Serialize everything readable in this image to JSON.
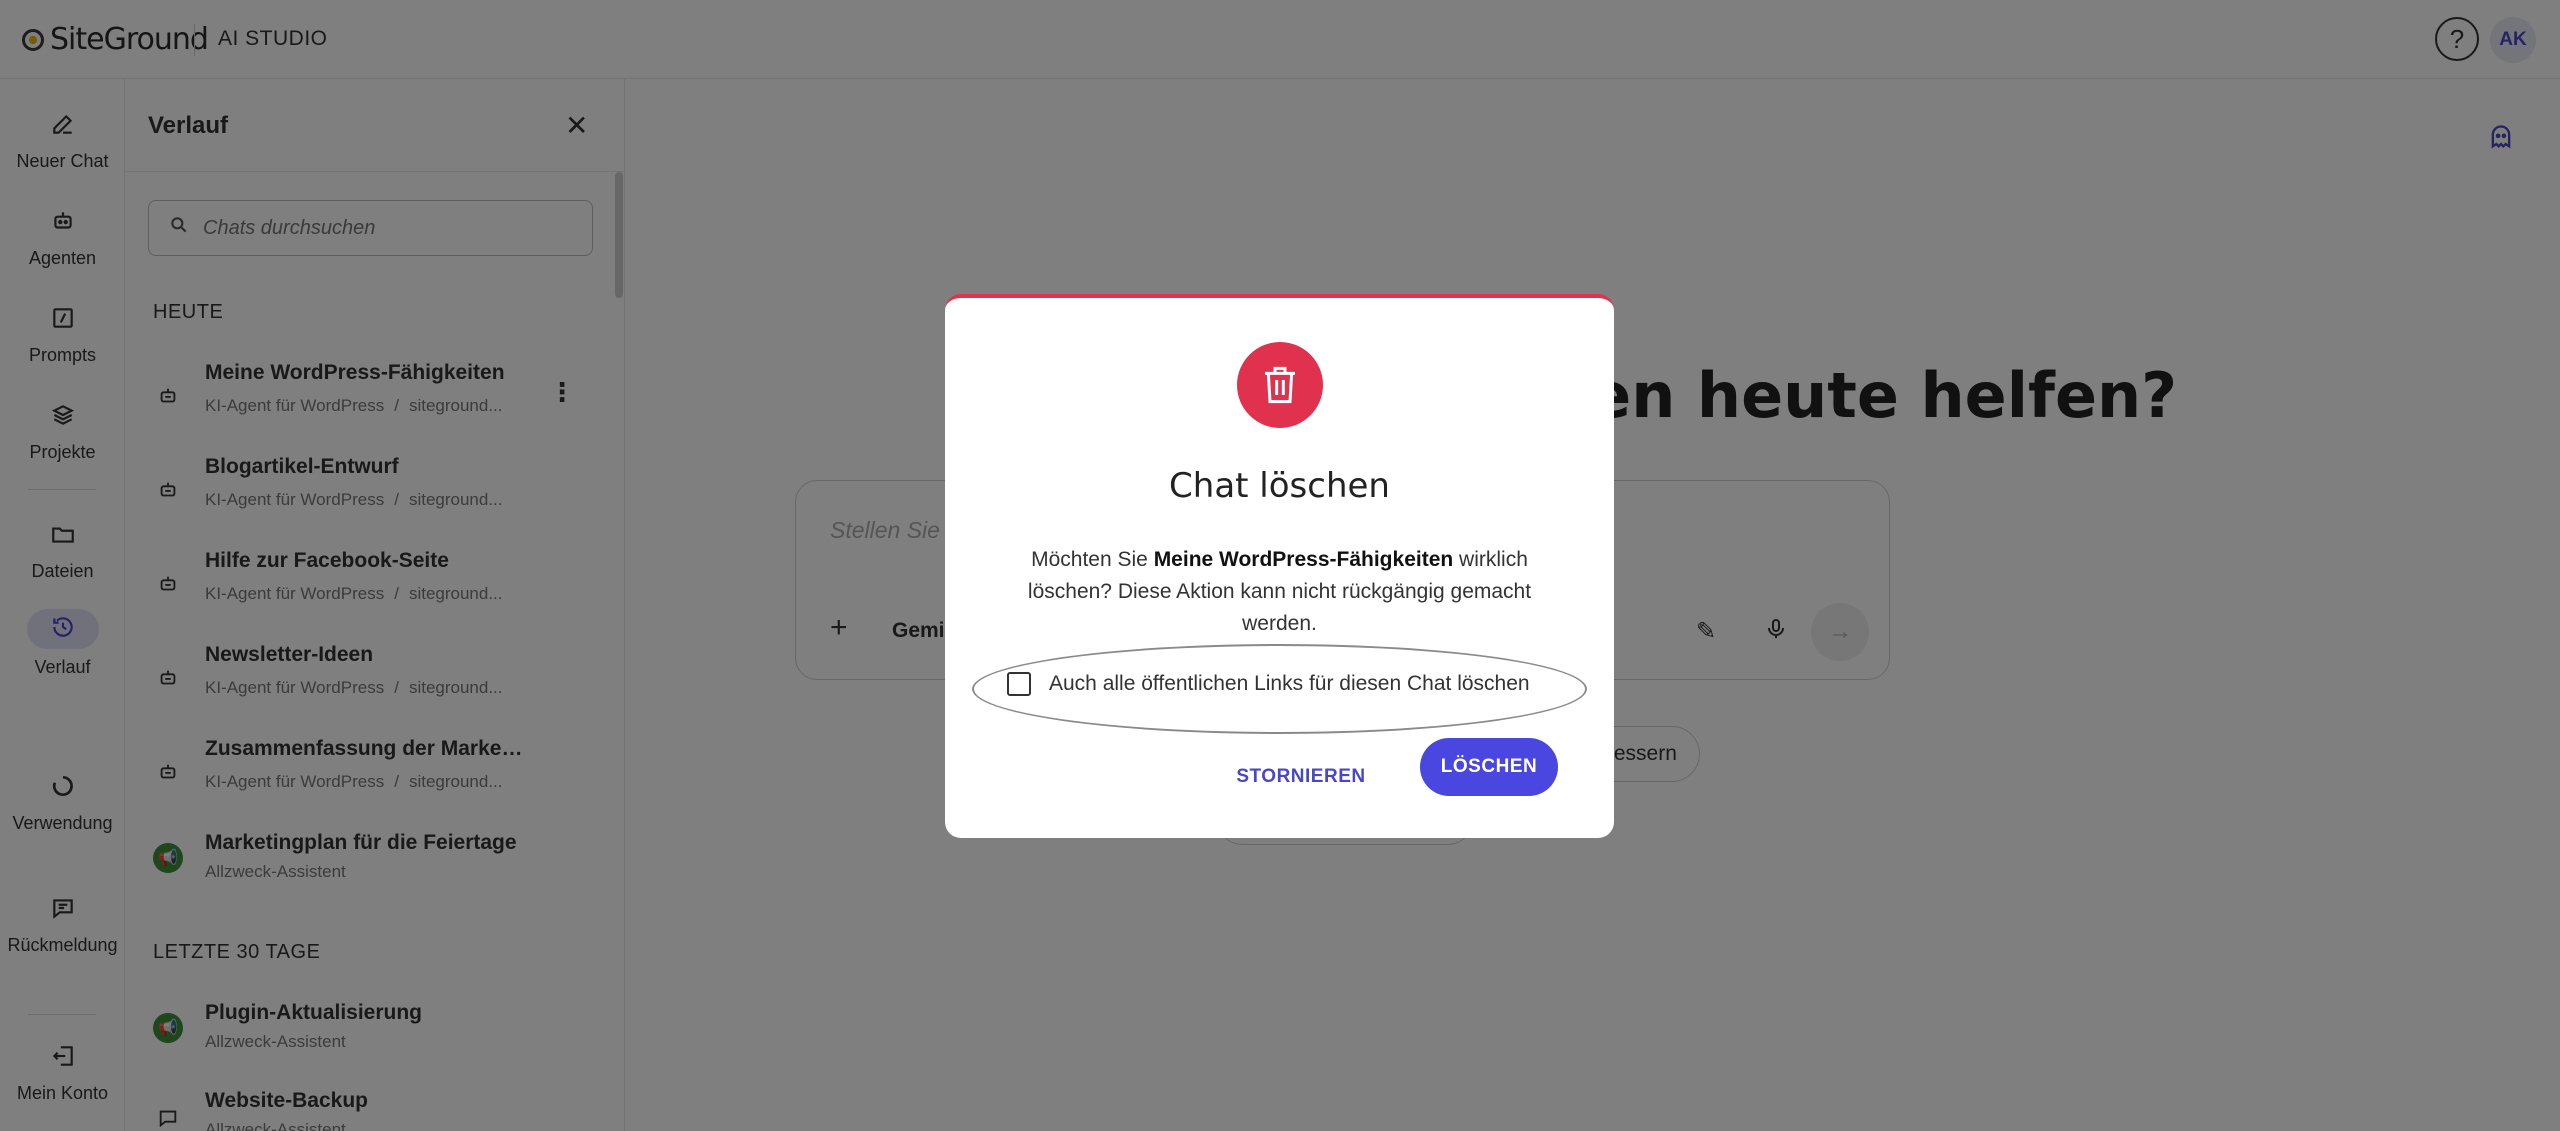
{
  "header": {
    "brand": "SiteGround",
    "app_title": "AI STUDIO",
    "help_icon": "question-icon",
    "avatar_initials": "AK"
  },
  "rail": {
    "items": [
      {
        "label": "Neuer Chat",
        "icon": "edit-icon"
      },
      {
        "label": "Agenten",
        "icon": "robot-icon"
      },
      {
        "label": "Prompts",
        "icon": "prompt-icon"
      },
      {
        "label": "Projekte",
        "icon": "layers-icon"
      },
      {
        "label": "Dateien",
        "icon": "folder-icon"
      },
      {
        "label": "Verlauf",
        "icon": "history-icon",
        "active": true
      },
      {
        "label": "Verwendung",
        "icon": "usage-icon"
      },
      {
        "label": "Rückmeldung",
        "icon": "feedback-icon"
      },
      {
        "label": "Mein Konto",
        "icon": "logout-icon"
      }
    ]
  },
  "history": {
    "title": "Verlauf",
    "search_placeholder": "Chats durchsuchen",
    "section_today": "HEUTE",
    "section_last30": "LETZTE 30 TAGE",
    "today": [
      {
        "title": "Meine WordPress-Fähigkeiten",
        "agent": "KI-Agent für WordPress",
        "site": "siteground..."
      },
      {
        "title": "Blogartikel-Entwurf",
        "agent": "KI-Agent für WordPress",
        "site": "siteground..."
      },
      {
        "title": "Hilfe zur Facebook-Seite",
        "agent": "KI-Agent für WordPress",
        "site": "siteground..."
      },
      {
        "title": "Newsletter-Ideen",
        "agent": "KI-Agent für WordPress",
        "site": "siteground..."
      },
      {
        "title": "Zusammenfassung der Markenr...",
        "agent": "KI-Agent für WordPress",
        "site": "siteground..."
      },
      {
        "title": "Marketingplan für die Feiertage",
        "agent": "Allzweck-Assistent"
      }
    ],
    "last30": [
      {
        "title": "Plugin-Aktualisierung",
        "agent": "Allzweck-Assistent"
      },
      {
        "title": "Website-Backup",
        "agent": "Allzweck-Assistent"
      }
    ],
    "separator": "/"
  },
  "main": {
    "greeting": "Wie kann ich Ihnen heute helfen?",
    "composer_placeholder": "Stellen Sie eine Frage oder nutzen Sie / für Prompts.",
    "model_label": "Gemini",
    "suggestion": "verbessern"
  },
  "modal": {
    "title": "Chat löschen",
    "text_before": "Möchten Sie ",
    "text_bold": "Meine WordPress-Fähigkeiten",
    "text_after": " wirklich löschen? Diese Aktion kann nicht rückgängig gemacht werden.",
    "checkbox_label": "Auch alle öffentlichen Links für diesen Chat löschen",
    "checkbox_checked": false,
    "cancel_label": "STORNIEREN",
    "delete_label": "LÖSCHEN",
    "accent_color": "#e0314e",
    "primary_color": "#4a47e0"
  }
}
